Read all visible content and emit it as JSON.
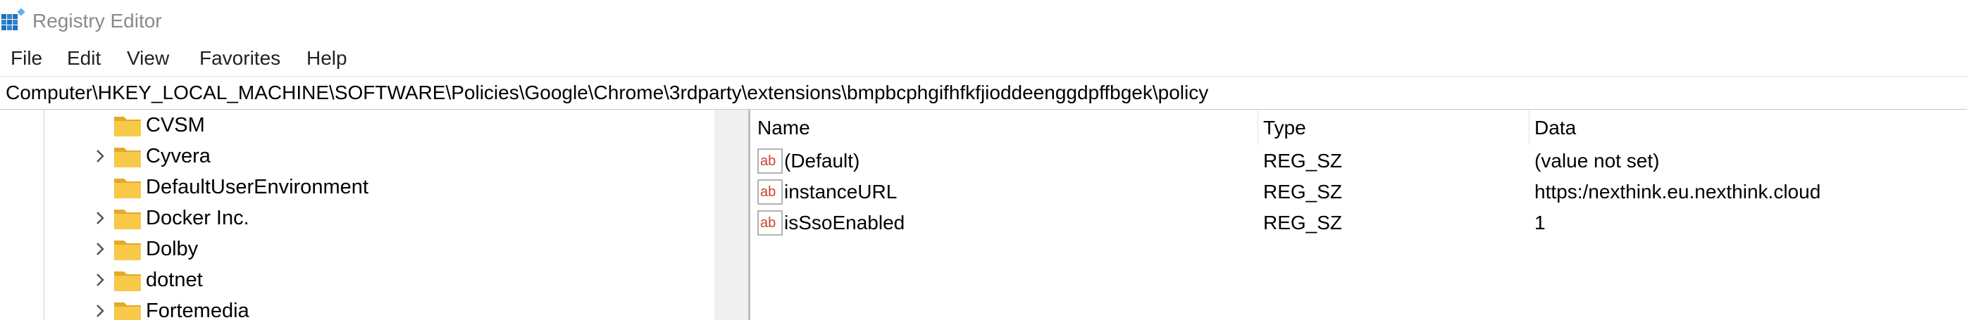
{
  "window": {
    "title": "Registry Editor",
    "app_icon": "registry-icon"
  },
  "menu": [
    "File",
    "Edit",
    "View",
    "Favorites",
    "Help"
  ],
  "address": "Computer\\HKEY_LOCAL_MACHINE\\SOFTWARE\\Policies\\Google\\Chrome\\3rdparty\\extensions\\bmpbcphgifhfkfjioddeenggdpffbgek\\policy",
  "tree": {
    "items": [
      {
        "label": "CVSM",
        "expandable": false
      },
      {
        "label": "Cyvera",
        "expandable": true
      },
      {
        "label": "DefaultUserEnvironment",
        "expandable": false
      },
      {
        "label": "Docker Inc.",
        "expandable": true
      },
      {
        "label": "Dolby",
        "expandable": true
      },
      {
        "label": "dotnet",
        "expandable": true
      },
      {
        "label": "Fortemedia",
        "expandable": true
      }
    ]
  },
  "list": {
    "columns": {
      "name": "Name",
      "type": "Type",
      "data": "Data"
    },
    "rows": [
      {
        "name": "(Default)",
        "type": "REG_SZ",
        "data": "(value not set)",
        "icon": "string-value-icon"
      },
      {
        "name": "instanceURL",
        "type": "REG_SZ",
        "data": "https:/nexthink.eu.nexthink.cloud",
        "icon": "string-value-icon"
      },
      {
        "name": "isSsoEnabled",
        "type": "REG_SZ",
        "data": "1",
        "icon": "string-value-icon"
      }
    ]
  },
  "colors": {
    "folder": "#F8C848",
    "folder_dark": "#E3A92A",
    "ab_red": "#C8432B"
  }
}
